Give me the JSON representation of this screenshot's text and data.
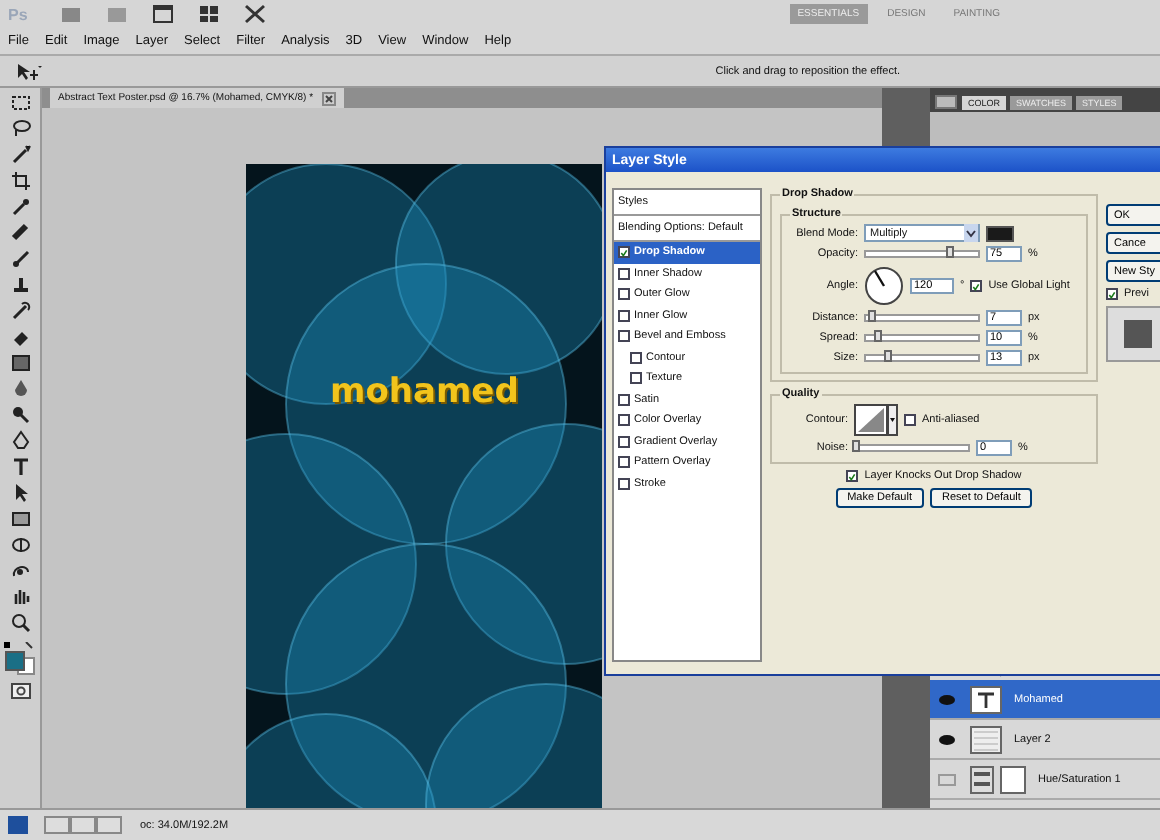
{
  "app_bar": {
    "logo": "Ps",
    "workspaces": [
      {
        "label": "ESSENTIALS",
        "selected": true
      },
      {
        "label": "DESIGN",
        "selected": false
      },
      {
        "label": "PAINTING",
        "selected": false
      }
    ]
  },
  "menu": [
    "File",
    "Edit",
    "Image",
    "Layer",
    "Select",
    "Filter",
    "Analysis",
    "3D",
    "View",
    "Window",
    "Help"
  ],
  "options_bar": {
    "hint": "Click and drag to reposition the effect."
  },
  "document": {
    "tab": "Abstract Text Poster.psd @ 16.7% (Mohamed, CMYK/8) *",
    "artwork_text": "mohamed"
  },
  "panel_tabs": [
    {
      "label": "COLOR",
      "selected": true
    },
    {
      "label": "SWATCHES",
      "selected": false
    },
    {
      "label": "STYLES",
      "selected": false
    }
  ],
  "layers": [
    {
      "name": "Mohamed",
      "kind": "text",
      "visible": true,
      "selected": true
    },
    {
      "name": "Layer 2",
      "kind": "pixel",
      "visible": true,
      "selected": false
    },
    {
      "name": "Hue/Saturation 1",
      "kind": "adjustment",
      "visible": false,
      "selected": false
    }
  ],
  "status_bar": {
    "doc_size": "oc: 34.0M/192.2M"
  },
  "dialog": {
    "title": "Layer Style",
    "styles_header": "Styles",
    "blending": "Blending Options: Default",
    "effects": [
      {
        "label": "Drop Shadow",
        "checked": true,
        "selected": true
      },
      {
        "label": "Inner Shadow",
        "checked": false,
        "selected": false
      },
      {
        "label": "Outer Glow",
        "checked": false,
        "selected": false
      },
      {
        "label": "Inner Glow",
        "checked": false,
        "selected": false
      },
      {
        "label": "Bevel and Emboss",
        "checked": false,
        "selected": false,
        "children": [
          {
            "label": "Contour",
            "checked": false,
            "selected": false
          },
          {
            "label": "Texture",
            "checked": false,
            "selected": false
          }
        ]
      },
      {
        "label": "Satin",
        "checked": false,
        "selected": false
      },
      {
        "label": "Color Overlay",
        "checked": false,
        "selected": false
      },
      {
        "label": "Gradient Overlay",
        "checked": false,
        "selected": false
      },
      {
        "label": "Pattern Overlay",
        "checked": false,
        "selected": false
      },
      {
        "label": "Stroke",
        "checked": false,
        "selected": false
      }
    ],
    "group_title": "Drop Shadow",
    "structure_title": "Structure",
    "blend_mode": {
      "label": "Blend Mode:",
      "value": "Multiply",
      "color": "#1a1a1a"
    },
    "opacity": {
      "label": "Opacity:",
      "level": 0.75,
      "value": "75",
      "unit": "%"
    },
    "angle": {
      "label": "Angle:",
      "value": "120",
      "unit": "°",
      "global_light": {
        "label": "Use Global Light",
        "checked": true
      }
    },
    "sliders": [
      {
        "label": "Distance:",
        "level": 0.05,
        "value": "7",
        "unit": "px"
      },
      {
        "label": "Spread:",
        "level": 0.1,
        "value": "10",
        "unit": "%"
      },
      {
        "label": "Size:",
        "level": 0.2,
        "value": "13",
        "unit": "px"
      }
    ],
    "quality_title": "Quality",
    "contour": {
      "label": "Contour:",
      "anti_aliased": {
        "label": "Anti-aliased",
        "checked": false
      }
    },
    "noise": {
      "label": "Noise:",
      "level": 0.0,
      "value": "0",
      "unit": "%"
    },
    "knockout": {
      "label": "Layer Knocks Out Drop Shadow",
      "checked": true
    },
    "actions": [
      "Make Default",
      "Reset to Default"
    ],
    "side_buttons": [
      "OK",
      "Cance",
      "New Sty"
    ],
    "preview": {
      "label": "Previ",
      "checked": true
    }
  }
}
